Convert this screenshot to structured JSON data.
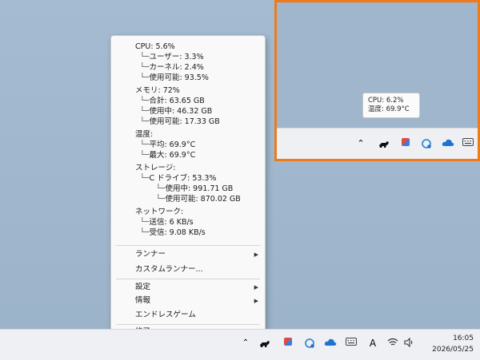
{
  "menu": {
    "cpu": "CPU: 5.6%",
    "cpu_user": "ユーザー: 3.3%",
    "cpu_kernel": "カーネル: 2.4%",
    "cpu_available": "使用可能: 93.5%",
    "memory": "メモリ: 72%",
    "mem_total": "合計: 63.65 GB",
    "mem_used": "使用中: 46.32 GB",
    "mem_available": "使用可能: 17.33 GB",
    "temp": "温度:",
    "temp_avg": "平均: 69.9°C",
    "temp_max": "最大: 69.9°C",
    "storage": "ストレージ:",
    "drive_c": "C ドライブ: 53.3%",
    "drive_used": "使用中: 991.71 GB",
    "drive_available": "使用可能: 870.02 GB",
    "network": "ネットワーク:",
    "net_send": "送信: 6 KB/s",
    "net_recv": "受信: 9.08 KB/s",
    "runner": "ランナー",
    "custom_runner": "カスタムランナー...",
    "settings": "設定",
    "info": "情報",
    "endless_game": "エンドレスゲーム",
    "exit": "終了"
  },
  "tooltip": {
    "cpu": "CPU: 6.2%",
    "temp": "温度: 69.9°C"
  },
  "taskbar": {
    "ime": "A",
    "time": "16:05",
    "date": "2026/05/25"
  },
  "colors": {
    "highlight": "#f07a18"
  }
}
